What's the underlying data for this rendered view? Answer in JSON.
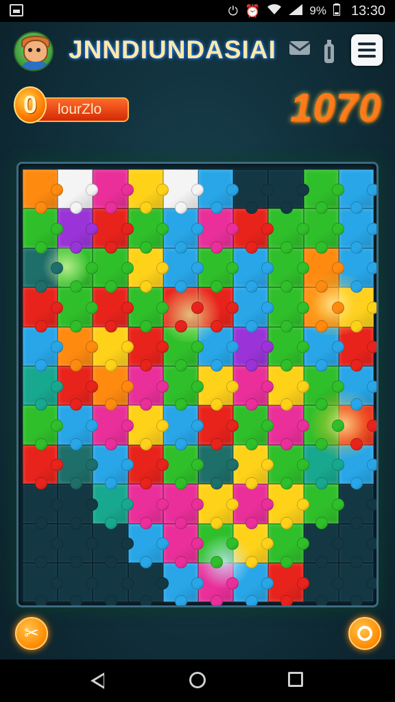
{
  "status_bar": {
    "battery": "9%",
    "time": "13:30",
    "icons": [
      "gallery-icon",
      "data-saver-icon",
      "alarm-icon",
      "wifi-icon",
      "signal-icon",
      "battery-icon"
    ]
  },
  "header": {
    "title": "JNNDIUNDASIAI",
    "avatar": "player-avatar",
    "icons": [
      "mail-icon",
      "bottle-icon",
      "menu-icon"
    ]
  },
  "level": {
    "number": "0",
    "label": "lourZlo"
  },
  "score": "1070",
  "board": {
    "columns": 10,
    "rows": 11,
    "colors": {
      "R": "#e8231c",
      "O": "#ff8a10",
      "Y": "#ffd21a",
      "G": "#2fbf2a",
      "B": "#28a6e8",
      "P": "#ea2f9a",
      "V": "#9a34d8",
      "W": "#f4f4f4",
      "T": "#18a890",
      "D": "#1e6f6a",
      "E": "#143744"
    },
    "rows_colors": [
      [
        "O",
        "W",
        "P",
        "Y",
        "W",
        "B",
        "E",
        "E",
        "G",
        "B"
      ],
      [
        "G",
        "V",
        "R",
        "G",
        "B",
        "P",
        "R",
        "G",
        "G",
        "B"
      ],
      [
        "D",
        "G",
        "G",
        "Y",
        "B",
        "G",
        "B",
        "G",
        "O",
        "B"
      ],
      [
        "R",
        "G",
        "R",
        "G",
        "R",
        "R",
        "B",
        "G",
        "O",
        "Y"
      ],
      [
        "B",
        "O",
        "Y",
        "R",
        "G",
        "B",
        "V",
        "G",
        "B",
        "R"
      ],
      [
        "T",
        "R",
        "O",
        "P",
        "G",
        "Y",
        "P",
        "Y",
        "G",
        "B"
      ],
      [
        "G",
        "B",
        "P",
        "Y",
        "B",
        "R",
        "G",
        "P",
        "G",
        "R"
      ],
      [
        "R",
        "D",
        "B",
        "R",
        "G",
        "D",
        "Y",
        "G",
        "T",
        "B"
      ],
      [
        "E",
        "E",
        "T",
        "P",
        "P",
        "Y",
        "P",
        "Y",
        "G",
        "E"
      ],
      [
        "E",
        "E",
        "E",
        "B",
        "P",
        "G",
        "Y",
        "G",
        "E",
        "E"
      ],
      [
        "E",
        "E",
        "E",
        "E",
        "B",
        "P",
        "B",
        "R",
        "E",
        "E"
      ]
    ]
  },
  "controls": {
    "shuffle": "shuffle-icon",
    "hint": "hint-icon"
  },
  "nav_bar": [
    "back-icon",
    "home-icon",
    "recents-icon"
  ]
}
